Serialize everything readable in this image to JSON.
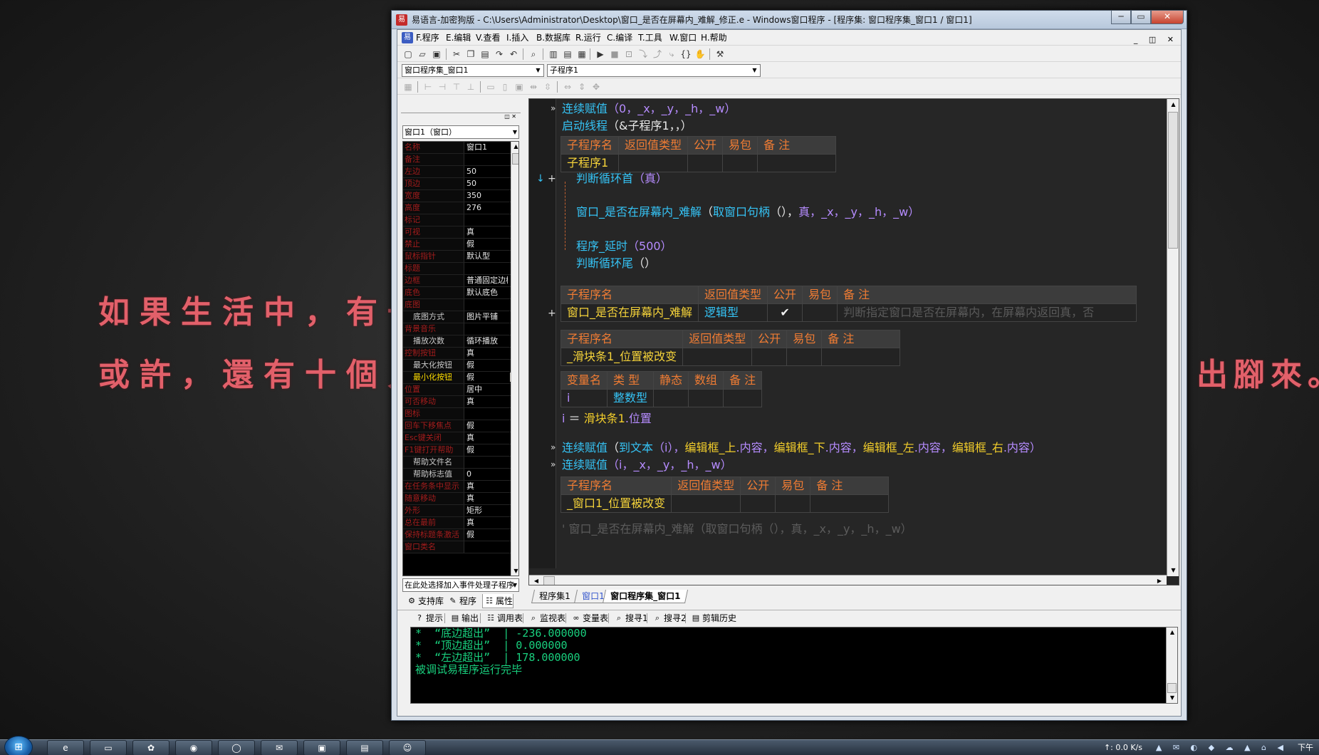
{
  "wallpaper": {
    "line1": "如果生活中，有一個",
    "line2": "或許，還有十個人想",
    "line3": "出腳來。"
  },
  "window": {
    "title": "易语言-加密狗版 - C:\\Users\\Administrator\\Desktop\\窗口_是否在屏幕内_难解_修正.e - Windows窗口程序 - [程序集: 窗口程序集_窗口1 / 窗口1]",
    "minimize": "─",
    "maximize": "▭",
    "close": "✕"
  },
  "menu": {
    "items": [
      "F.程序",
      "E.编辑",
      "V.查看",
      "I.插入",
      "B.数据库",
      "R.运行",
      "C.编译",
      "T.工具",
      "W.窗口",
      "H.帮助"
    ],
    "mdi": "_ ◫ ✕"
  },
  "toolbar1": {
    "icons": [
      "new-file",
      "open-folder",
      "save",
      "cut",
      "copy",
      "paste",
      "redo",
      "undo",
      "find",
      "layout-a",
      "layout-b",
      "layout-c",
      "run",
      "stop",
      "step-a",
      "step-b",
      "step-c",
      "step-d",
      "hand",
      "tool"
    ]
  },
  "selectors": {
    "module": "窗口程序集_窗口1",
    "subroutine": "子程序1"
  },
  "left_panel": {
    "object_combo": "窗口1（窗口）",
    "properties": [
      {
        "k": "名称",
        "v": "窗口1"
      },
      {
        "k": "备注",
        "v": ""
      },
      {
        "k": "左边",
        "v": "50"
      },
      {
        "k": "顶边",
        "v": "50"
      },
      {
        "k": "宽度",
        "v": "350"
      },
      {
        "k": "高度",
        "v": "276"
      },
      {
        "k": "标记",
        "v": ""
      },
      {
        "k": "可视",
        "v": "真"
      },
      {
        "k": "禁止",
        "v": "假"
      },
      {
        "k": "鼠标指针",
        "v": "默认型"
      },
      {
        "k": "标题",
        "v": ""
      },
      {
        "k": "边框",
        "v": "普通固定边框"
      },
      {
        "k": "底色",
        "v": "默认底色"
      },
      {
        "k": "底图",
        "v": ""
      },
      {
        "k": "底图方式",
        "v": "图片平铺",
        "ind": true
      },
      {
        "k": "背景音乐",
        "v": ""
      },
      {
        "k": "播放次数",
        "v": "循环播放",
        "ind": true
      },
      {
        "k": "控制按钮",
        "v": "真"
      },
      {
        "k": "最大化按钮",
        "v": "假",
        "ind": true
      },
      {
        "k": "最小化按钮",
        "v": "假",
        "sel": true
      },
      {
        "k": "位置",
        "v": "居中"
      },
      {
        "k": "可否移动",
        "v": "真"
      },
      {
        "k": "图标",
        "v": ""
      },
      {
        "k": "回车下移焦点",
        "v": "假"
      },
      {
        "k": "Esc键关闭",
        "v": "真"
      },
      {
        "k": "F1键打开帮助",
        "v": "假"
      },
      {
        "k": "帮助文件名",
        "v": "",
        "ind": true
      },
      {
        "k": "帮助标志值",
        "v": "0",
        "ind": true
      },
      {
        "k": "在任务条中显示",
        "v": "真"
      },
      {
        "k": "随意移动",
        "v": "真"
      },
      {
        "k": "外形",
        "v": "矩形"
      },
      {
        "k": "总在最前",
        "v": "真"
      },
      {
        "k": "保持标题条激活",
        "v": "假"
      },
      {
        "k": "窗口类名",
        "v": ""
      }
    ],
    "event_combo": "在此处选择加入事件处理子程序",
    "tabs": [
      {
        "icon": "⚙",
        "label": "支持库"
      },
      {
        "icon": "✎",
        "label": "程序"
      },
      {
        "icon": "☷",
        "label": "属性"
      }
    ]
  },
  "code": {
    "line1": {
      "fn": "连续赋值",
      "args": "（0，_x，_y，_h，_w）"
    },
    "line2": {
      "fn": "启动线程",
      "args": "（&子程序1，，）"
    },
    "t1": {
      "headers": [
        "子程序名",
        "返回值类型",
        "公开",
        "易包",
        "备 注"
      ],
      "name": "子程序1"
    },
    "loop_start": {
      "fn": "判断循环首",
      "args": "（真）"
    },
    "loop_call": {
      "fn": "窗口_是否在屏幕内_难解",
      "p1": "（",
      "fn2": "取窗口句柄",
      "p2": "（），",
      "args": "真，_x，_y，_h，_w）"
    },
    "delay": {
      "fn": "程序_延时",
      "args": "（500）"
    },
    "loop_end": {
      "fn": "判断循环尾",
      "args": "（）"
    },
    "t2": {
      "headers": [
        "子程序名",
        "返回值类型",
        "公开",
        "易包",
        "备 注"
      ],
      "name": "窗口_是否在屏幕内_难解",
      "ret": "逻辑型",
      "pub": "✔",
      "note": "判断指定窗口是否在屏幕内，在屏幕内返回真，否"
    },
    "t3": {
      "headers": [
        "子程序名",
        "返回值类型",
        "公开",
        "易包",
        "备 注"
      ],
      "name": "_滑块条1_位置被改变"
    },
    "t4": {
      "headers": [
        "变量名",
        "类 型",
        "静态",
        "数组",
        "备 注"
      ],
      "var": "i",
      "type": "整数型"
    },
    "assign": {
      "lhs": "i",
      "op": "＝",
      "obj": "滑块条1",
      "prop": ".位置"
    },
    "line3": {
      "fn": "连续赋值",
      "p1": "（",
      "fn2": "到文本",
      "p2": "（i），",
      "o1": "编辑框_上",
      "x1": ".内容，",
      "o2": "编辑框_下",
      "x2": ".内容，",
      "o3": "编辑框_左",
      "x3": ".内容，",
      "o4": "编辑框_右",
      "x4": ".内容）"
    },
    "line4": {
      "fn": "连续赋值",
      "args": "（i，_x，_y，_h，_w）"
    },
    "t5": {
      "headers": [
        "子程序名",
        "返回值类型",
        "公开",
        "易包",
        "备 注"
      ],
      "name": "_窗口1_位置被改变"
    },
    "comment": "'  窗口_是否在屏幕内_难解（取窗口句柄（），真，_x，_y，_h，_w）",
    "gutter_marks": [
      "»",
      "»",
      "↓",
      "+",
      "+",
      "»",
      "»"
    ]
  },
  "editor_tabs": [
    "程序集1",
    "窗口1",
    "窗口程序集_窗口1"
  ],
  "bottom_tabs": [
    {
      "icon": "?",
      "label": "提示"
    },
    {
      "icon": "▤",
      "label": "输出"
    },
    {
      "icon": "☷",
      "label": "调用表"
    },
    {
      "icon": "⌕",
      "label": "监视表"
    },
    {
      "icon": "∞",
      "label": "变量表"
    },
    {
      "icon": "⌕",
      "label": "搜寻1"
    },
    {
      "icon": "⌕",
      "label": "搜寻2"
    },
    {
      "icon": "▤",
      "label": "剪辑历史"
    }
  ],
  "output": [
    "*  “底边超出”  | -236.000000",
    "*  “顶边超出”  | 0.000000",
    "*  “左边超出”  | 178.000000",
    "被调试易程序运行完毕"
  ],
  "taskbar": {
    "start": "⊞",
    "apps": [
      "e",
      "▭",
      "✿",
      "◉",
      "◯",
      "✉",
      "▣",
      "▤",
      "☺"
    ],
    "net": "↑: 0.0 K/s",
    "tray_icons": "▲ ✉ ◐ ◆ ☁ ▲ ⌂ ◀",
    "clock": "下午"
  },
  "colors": {
    "function": "#35c3f5",
    "variable": "#b68cff",
    "keyword": "#f2cd2b",
    "header": "#f07c33",
    "output": "#19d07e",
    "wallpaper_text": "#e2606a"
  }
}
